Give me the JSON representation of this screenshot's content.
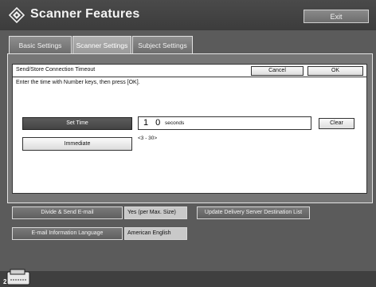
{
  "app": {
    "title": "Scanner Features",
    "exit_label": "Exit"
  },
  "tabs": [
    {
      "label": "Basic Settings"
    },
    {
      "label": "Scanner Settings"
    },
    {
      "label": "Subject Settings"
    }
  ],
  "dialog": {
    "title": "Send/Store Connection Timeout",
    "instruction": "Enter the time with Number keys, then press [OK].",
    "cancel_label": "Cancel",
    "ok_label": "OK",
    "set_time_label": "Set Time",
    "immediate_label": "Immediate",
    "value": "1 0",
    "unit": "seconds",
    "clear_label": "Clear",
    "range": "<3 - 30>"
  },
  "settings": {
    "divide_label": "Divide & Send E-mail",
    "divide_value": "Yes (per Max. Size)",
    "update_label": "Update Delivery Server Destination List",
    "language_label": "E-mail Information Language",
    "language_value": "American English"
  },
  "status": {
    "counter": "2"
  },
  "icons": {
    "logo": "diamond-logo-icon",
    "scanner": "scanner-icon"
  },
  "colors": {
    "panel": "#767676",
    "button_dark": "#4a4a4a"
  }
}
